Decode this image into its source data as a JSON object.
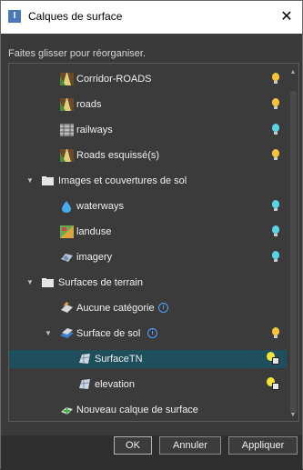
{
  "window": {
    "title": "Calques de surface",
    "close": "✕"
  },
  "hint": "Faites glisser pour réorganiser.",
  "tree": [
    {
      "label": "Corridor-ROADS",
      "icon": "road-corridor-icon",
      "bulb": "#f5c33b"
    },
    {
      "label": "roads",
      "icon": "road-icon",
      "bulb": "#f5c33b"
    },
    {
      "label": "railways",
      "icon": "railway-icon",
      "bulb": "#5bd1e6"
    },
    {
      "label": "Roads esquissé(s)",
      "icon": "sketched-road-icon",
      "bulb": "#f5c33b"
    },
    {
      "label": "Images et couvertures de sol",
      "icon": "folder-icon"
    },
    {
      "label": "waterways",
      "icon": "water-drop-icon",
      "bulb": "#5bd1e6"
    },
    {
      "label": "landuse",
      "icon": "landuse-icon",
      "bulb": "#5bd1e6"
    },
    {
      "label": "imagery",
      "icon": "imagery-icon",
      "bulb": "#5bd1e6"
    },
    {
      "label": "Surfaces de terrain",
      "icon": "folder-icon"
    },
    {
      "label": "Aucune catégorie",
      "icon": "surface-category-icon"
    },
    {
      "label": "Surface de sol",
      "icon": "ground-surface-icon",
      "bulb": "#f5c33b"
    },
    {
      "label": "SurfaceTN",
      "icon": "terrain-surface-icon"
    },
    {
      "label": "elevation",
      "icon": "terrain-surface-icon"
    },
    {
      "label": "Nouveau calque de surface",
      "icon": "new-surface-layer-icon"
    }
  ],
  "info_glyph": "i",
  "buttons": {
    "ok": "OK",
    "cancel": "Annuler",
    "apply": "Appliquer"
  }
}
